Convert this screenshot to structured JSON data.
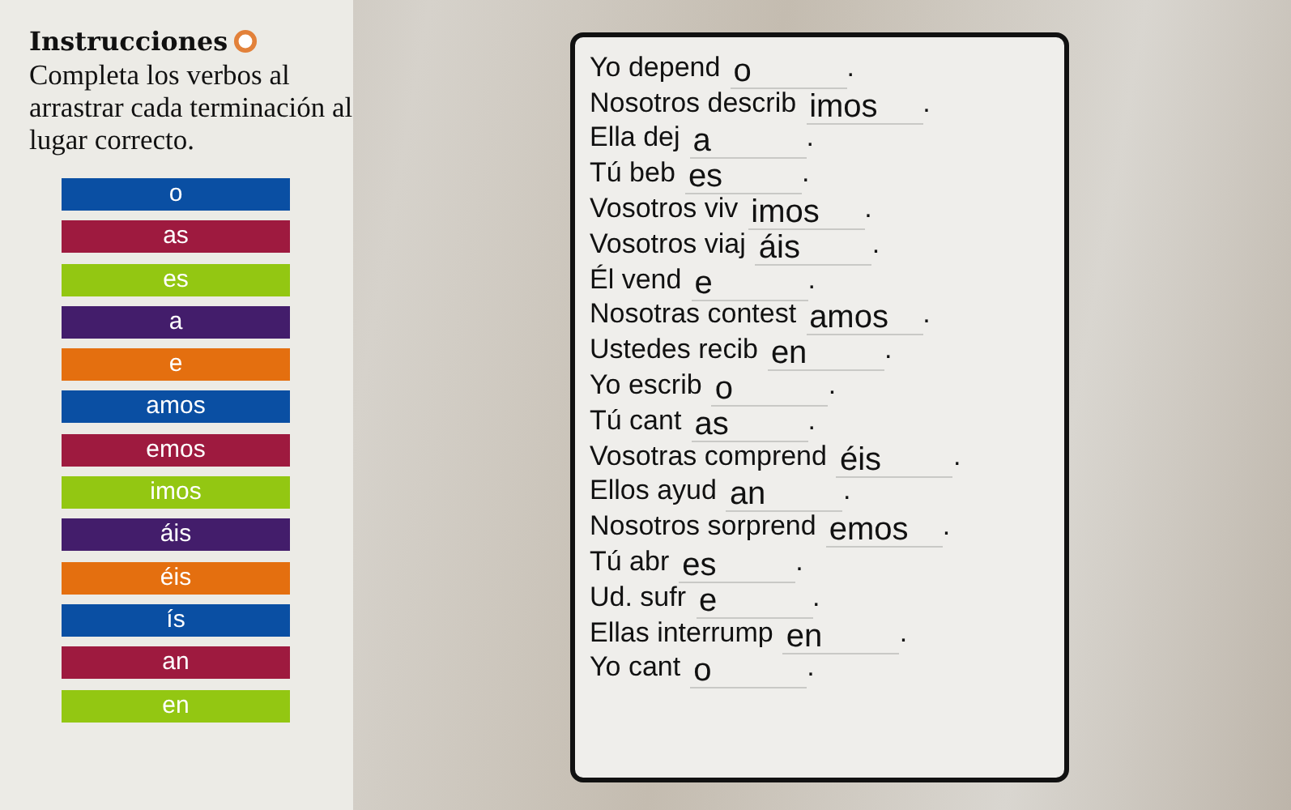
{
  "instructions": {
    "title": "Instrucciones",
    "text": "Completa los verbos al arrastrar cada terminación al lugar correcto."
  },
  "endings": [
    {
      "label": "o",
      "color": "#0a4fa3"
    },
    {
      "label": "as",
      "color": "#9e1a3f"
    },
    {
      "label": "es",
      "color": "#93c712"
    },
    {
      "label": "a",
      "color": "#431d6b"
    },
    {
      "label": "e",
      "color": "#e46f0f"
    },
    {
      "label": "amos",
      "color": "#0a4fa3"
    },
    {
      "label": "emos",
      "color": "#9e1a3f"
    },
    {
      "label": "imos",
      "color": "#93c712"
    },
    {
      "label": "áis",
      "color": "#431d6b"
    },
    {
      "label": "éis",
      "color": "#e46f0f"
    },
    {
      "label": "ís",
      "color": "#0a4fa3"
    },
    {
      "label": "an",
      "color": "#9e1a3f"
    },
    {
      "label": "en",
      "color": "#93c712"
    }
  ],
  "sentences": [
    {
      "stem": "Yo depend",
      "answer": "o",
      "end": "."
    },
    {
      "stem": "Nosotros describ",
      "answer": "imos",
      "end": "."
    },
    {
      "stem": "Ella dej",
      "answer": "a",
      "end": "."
    },
    {
      "stem": "Tú beb",
      "answer": "es",
      "end": "."
    },
    {
      "stem": "Vosotros viv",
      "answer": "imos",
      "end": "."
    },
    {
      "stem": "Vosotros viaj",
      "answer": "áis",
      "end": "."
    },
    {
      "stem": "Él vend",
      "answer": "e",
      "end": "."
    },
    {
      "stem": "Nosotras contest",
      "answer": "amos",
      "end": "."
    },
    {
      "stem": "Ustedes recib",
      "answer": "en",
      "end": "."
    },
    {
      "stem": "Yo escrib",
      "answer": "o",
      "end": "."
    },
    {
      "stem": "Tú cant",
      "answer": "as",
      "end": "."
    },
    {
      "stem": "Vosotras comprend",
      "answer": "éis",
      "end": "."
    },
    {
      "stem": "Ellos ayud",
      "answer": "an",
      "end": "."
    },
    {
      "stem": "Nosotros sorprend",
      "answer": "emos",
      "end": "."
    },
    {
      "stem": "Tú abr",
      "answer": "es",
      "end": "."
    },
    {
      "stem": "Ud. sufr",
      "answer": "e",
      "end": "."
    },
    {
      "stem": "Ellas interrump",
      "answer": "en",
      "end": "."
    },
    {
      "stem": "Yo cant",
      "answer": "o",
      "end": "."
    }
  ]
}
